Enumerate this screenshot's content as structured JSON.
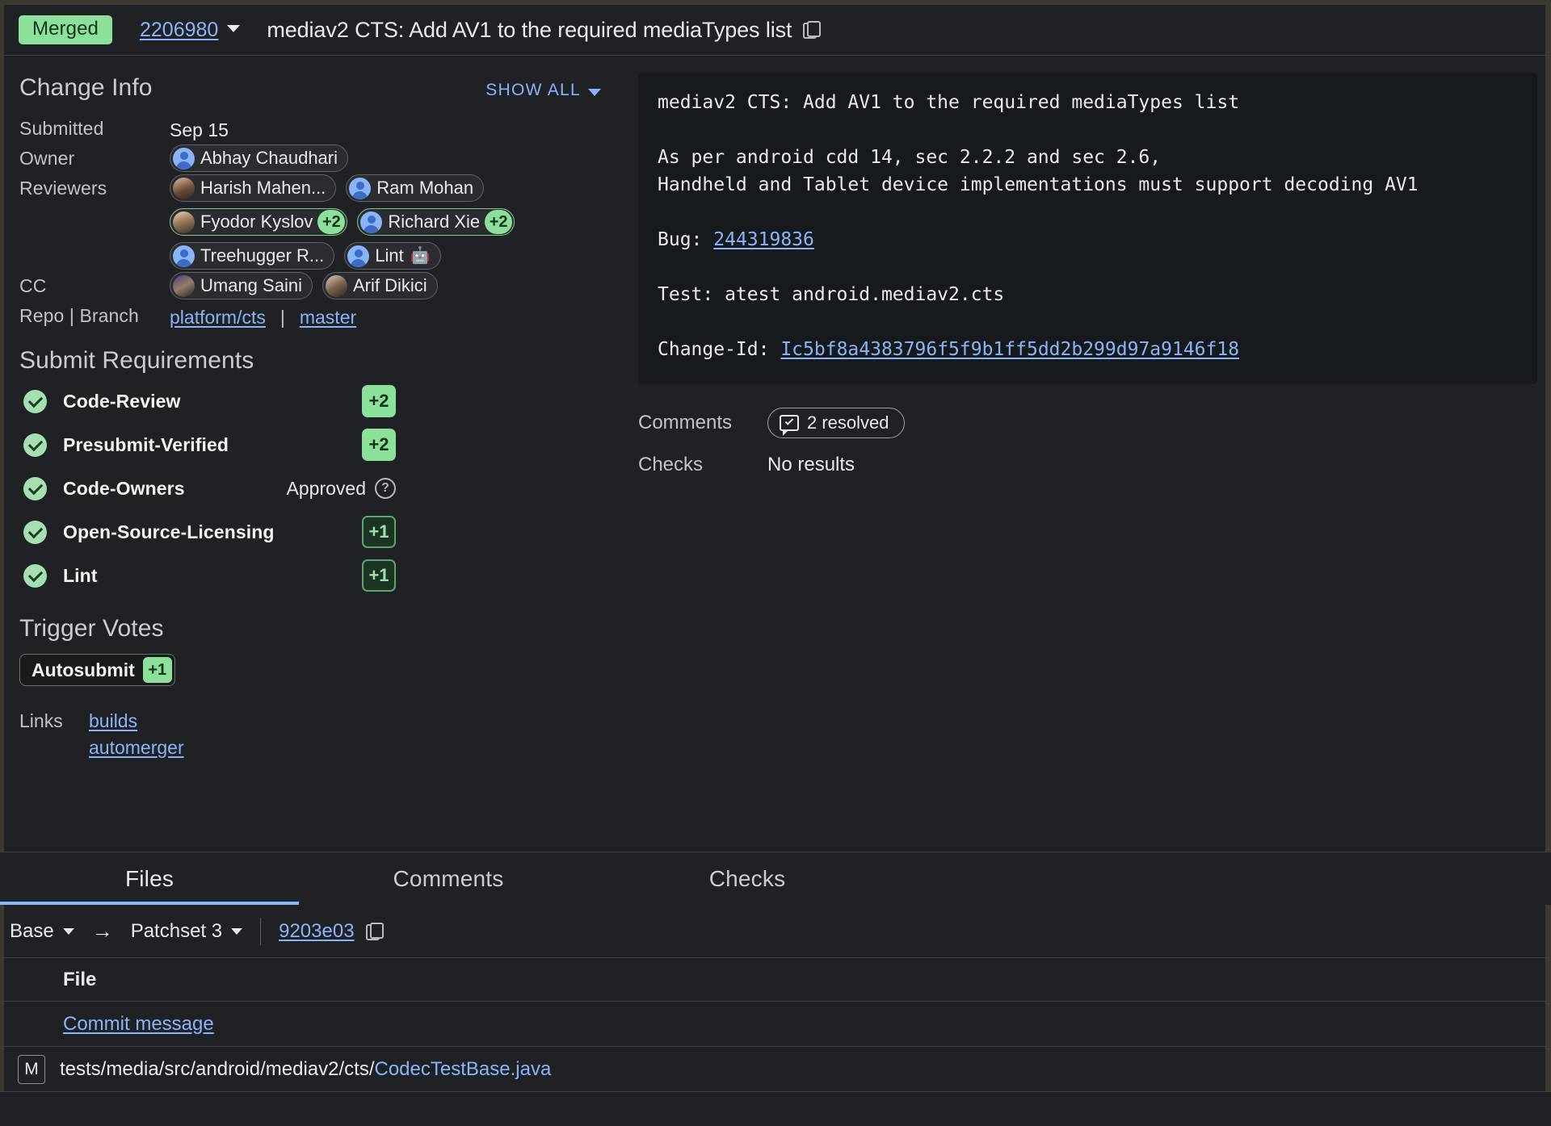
{
  "header": {
    "status": "Merged",
    "change_number": "2206980",
    "title": "mediav2 CTS: Add AV1 to the required mediaTypes list",
    "copy_icon": "copy-icon",
    "caret_icon": "chevron-down-icon"
  },
  "change_info": {
    "section_title": "Change Info",
    "show_all_label": "SHOW ALL",
    "labels": {
      "submitted": "Submitted",
      "owner": "Owner",
      "reviewers": "Reviewers",
      "cc": "CC",
      "repo_branch": "Repo | Branch"
    },
    "submitted_value": "Sep 15",
    "owner": {
      "name": "Abhay Chaudhari",
      "avatar": "generic",
      "vote": ""
    },
    "reviewers": [
      {
        "name": "Harish Mahen...",
        "avatar": "photo-a",
        "vote": ""
      },
      {
        "name": "Ram Mohan",
        "avatar": "generic",
        "vote": ""
      },
      {
        "name": "Fyodor Kyslov",
        "avatar": "photo-b",
        "vote": "+2"
      },
      {
        "name": "Richard Xie",
        "avatar": "generic",
        "vote": "+2"
      },
      {
        "name": "Treehugger R...",
        "avatar": "generic",
        "vote": ""
      },
      {
        "name": "Lint",
        "avatar": "generic",
        "vote": "",
        "bot": "🤖"
      }
    ],
    "cc": [
      {
        "name": "Umang Saini",
        "avatar": "photo-c"
      },
      {
        "name": "Arif Dikici",
        "avatar": "photo-d"
      }
    ],
    "repo": "platform/cts",
    "branch": "master",
    "branch_separator": "|"
  },
  "submit_requirements": {
    "title": "Submit Requirements",
    "items": [
      {
        "name": "Code-Review",
        "value": "+2",
        "style": "max"
      },
      {
        "name": "Presubmit-Verified",
        "value": "+2",
        "style": "max"
      },
      {
        "name": "Code-Owners",
        "value": "Approved",
        "style": "text"
      },
      {
        "name": "Open-Source-Licensing",
        "value": "+1",
        "style": "pos"
      },
      {
        "name": "Lint",
        "value": "+1",
        "style": "pos"
      }
    ]
  },
  "trigger_votes": {
    "title": "Trigger Votes",
    "items": [
      {
        "name": "Autosubmit",
        "value": "+1"
      }
    ]
  },
  "links": {
    "label": "Links",
    "items": [
      "builds",
      "automerger"
    ]
  },
  "commit_message": {
    "subject": "mediav2 CTS: Add AV1 to the required mediaTypes list",
    "body_line1": "As per android cdd 14, sec 2.2.2 and sec 2.6,",
    "body_line2": "Handheld and Tablet device implementations must support decoding AV1",
    "bug_label": "Bug: ",
    "bug_id": "244319836",
    "test_line": "Test: atest android.mediav2.cts",
    "change_id_label": "Change-Id: ",
    "change_id": "Ic5bf8a4383796f5f9b1ff5dd2b299d97a9146f18"
  },
  "meta": {
    "comments_label": "Comments",
    "comments_value": "2 resolved",
    "checks_label": "Checks",
    "checks_value": "No results"
  },
  "tabs": [
    {
      "label": "Files",
      "active": true
    },
    {
      "label": "Comments",
      "active": false
    },
    {
      "label": "Checks",
      "active": false
    }
  ],
  "patchset_bar": {
    "base_label": "Base",
    "arrow": "→",
    "patchset_label": "Patchset 3",
    "commit_hash": "9203e03"
  },
  "files": {
    "column_header": "File",
    "commit_message_row": "Commit message",
    "rows": [
      {
        "status": "M",
        "path_prefix": "tests/media/src/android/mediav2/cts/",
        "path_base": "CodecTestBase.java"
      }
    ]
  },
  "colors": {
    "accent_blue": "#8ab4f8",
    "merged_green": "#8be09a",
    "background": "#202124",
    "panel": "#171a1c"
  }
}
